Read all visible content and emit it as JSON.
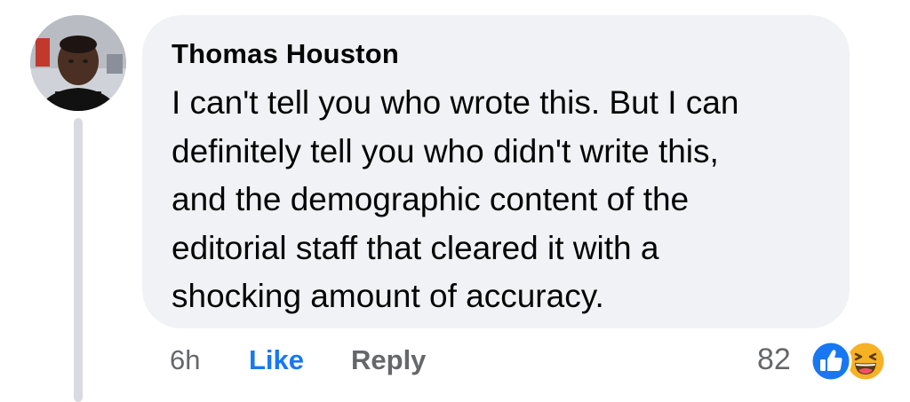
{
  "comment": {
    "author": "Thomas Houston",
    "text": "I can't tell you who wrote this. But I can\ndefinitely tell you who didn't write this,\nand the demographic content of the\neditorial staff that cleared it with a\nshocking amount of accuracy.",
    "avatar_icon": "avatar-photo"
  },
  "actions": {
    "time": "6h",
    "like_label": "Like",
    "reply_label": "Reply"
  },
  "reactions": {
    "count": "82",
    "icons": [
      "like-reaction-icon",
      "haha-reaction-icon"
    ]
  },
  "colors": {
    "bubble": "#f0f2f5",
    "like_blue": "#1877f2",
    "muted": "#65676b",
    "text": "#050505",
    "haha_yellow": "#f7b125"
  }
}
